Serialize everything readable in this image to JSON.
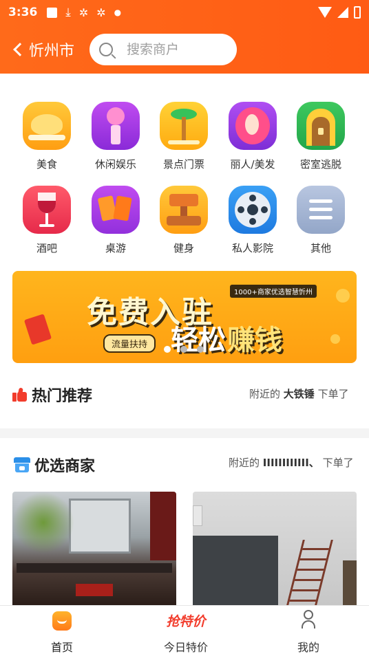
{
  "status": {
    "time": "3:36",
    "icons": [
      "a-icon",
      "download-icon",
      "bug-icon",
      "bug-icon",
      "dot-icon"
    ]
  },
  "header": {
    "city": "忻州市",
    "search_placeholder": "搜索商户"
  },
  "categories": [
    {
      "label": "美食",
      "icon": "food-icon"
    },
    {
      "label": "休闲娱乐",
      "icon": "microphone-icon"
    },
    {
      "label": "景点门票",
      "icon": "palm-tree-icon"
    },
    {
      "label": "丽人/美发",
      "icon": "beauty-icon"
    },
    {
      "label": "密室逃脱",
      "icon": "escape-room-icon"
    },
    {
      "label": "酒吧",
      "icon": "wine-glass-icon"
    },
    {
      "label": "桌游",
      "icon": "cards-icon"
    },
    {
      "label": "健身",
      "icon": "dumbbell-icon"
    },
    {
      "label": "私人影院",
      "icon": "film-reel-icon"
    },
    {
      "label": "其他",
      "icon": "list-icon"
    }
  ],
  "banner": {
    "line1": "免费入驻",
    "line2a": "轻松",
    "line2b": "赚钱",
    "tag": "1000+商家优选智慧忻州",
    "pill": "流量扶持",
    "slides": 3,
    "active_slide": 1
  },
  "hot": {
    "title": "热门推荐",
    "note_prefix": "附近的",
    "note_name": "大铁锤",
    "note_suffix": "下单了"
  },
  "merchants": {
    "title": "优选商家",
    "note_prefix": "附近的",
    "note_name": "IIIIIIIIIIII、",
    "note_suffix": "下单了"
  },
  "tabs": [
    {
      "label": "首页",
      "icon": "home-icon"
    },
    {
      "label": "今日特价",
      "icon": "special-price-icon",
      "badge": "抢特价"
    },
    {
      "label": "我的",
      "icon": "user-icon"
    }
  ],
  "colors": {
    "brand": "#ff6a1a",
    "hot": "#f23c2c",
    "shop": "#2b8fe8"
  }
}
